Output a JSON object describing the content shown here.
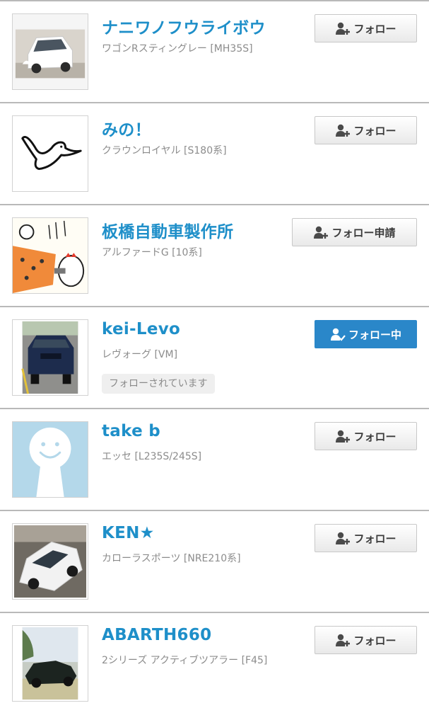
{
  "users": [
    {
      "name": "ナニワノフウライボウ",
      "car": "ワゴンRスティングレー [MH35S]",
      "button": "フォロー",
      "following": false,
      "follows_you": "",
      "avatar_icon": "white-wagon-car-photo"
    },
    {
      "name": "みの！",
      "car": "クラウンロイヤル [S180系]",
      "button": "フォロー",
      "following": false,
      "follows_you": "",
      "avatar_icon": "bird-drawing"
    },
    {
      "name": "板橋自動車製作所",
      "car": "アルファードG [10系]",
      "button": "フォロー申請",
      "following": false,
      "follows_you": "",
      "avatar_icon": "manga-illustration"
    },
    {
      "name": "kei-Levo",
      "car": "レヴォーグ [VM]",
      "button": "フォロー中",
      "following": true,
      "follows_you": "フォローされています",
      "avatar_icon": "blue-subaru-car-photo"
    },
    {
      "name": "take b",
      "car": "エッセ [L235S/245S]",
      "button": "フォロー",
      "following": false,
      "follows_you": "",
      "avatar_icon": "default-smiley-avatar"
    },
    {
      "name": "KEN★",
      "car": "カローラスポーツ [NRE210系]",
      "button": "フォロー",
      "following": false,
      "follows_you": "",
      "avatar_icon": "white-corolla-car-photo"
    },
    {
      "name": "ABARTH660",
      "car": "2シリーズ アクティブツアラー [F45]",
      "button": "フォロー",
      "following": false,
      "follows_you": "",
      "avatar_icon": "dark-sports-car-photo"
    }
  ],
  "colors": {
    "accent": "#1e8fc9",
    "following_bg": "#2a87c9",
    "subtext": "#8c8c8c"
  }
}
